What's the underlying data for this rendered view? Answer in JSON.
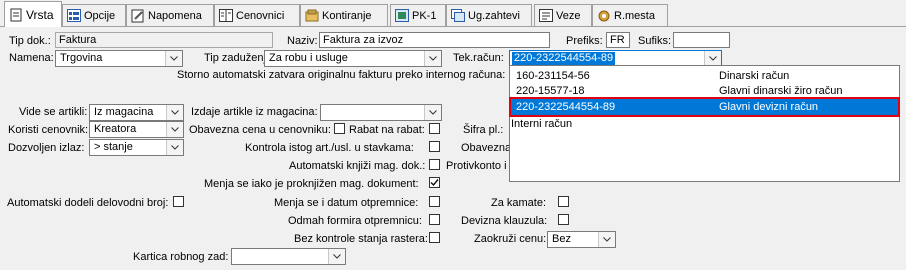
{
  "tabs": [
    {
      "label": "Vrsta",
      "icon": "document-icon"
    },
    {
      "label": "Opcije",
      "icon": "options-grid-icon"
    },
    {
      "label": "Napomena",
      "icon": "note-icon"
    },
    {
      "label": "Cenovnici",
      "icon": "price-list-icon"
    },
    {
      "label": "Kontiranje",
      "icon": "accounting-icon"
    },
    {
      "label": "PK-1",
      "icon": "pk1-icon"
    },
    {
      "label": "Ug.zahtevi",
      "icon": "requirements-icon"
    },
    {
      "label": "Veze",
      "icon": "links-icon"
    },
    {
      "label": "R.mesta",
      "icon": "cost-center-icon"
    }
  ],
  "form": {
    "tip_dok_label": "Tip dok.:",
    "tip_dok_value": "Faktura",
    "naziv_label": "Naziv:",
    "naziv_value": "Faktura za izvoz",
    "prefiks_label": "Prefiks:",
    "prefiks_value": "FR",
    "sufiks_label": "Sufiks:",
    "sufiks_value": "",
    "namena_label": "Namena:",
    "namena_value": "Trgovina",
    "tip_zaduzenja_label": "Tip zaduženja:",
    "tip_zaduzenja_value": "Za robu i usluge",
    "tek_racun_label": "Tek.račun:",
    "tek_racun_value": "220-2322544554-89",
    "storno_label": "Storno automatski zatvara originalnu fakturu preko internog računa:",
    "vide_se_artikli_label": "Vide se artikli:",
    "vide_se_artikli_value": "Iz magacina",
    "izdaje_artikle_label": "Izdaje artikle iz magacina:",
    "izdaje_artikle_value": "",
    "koristi_cenovnik_label": "Koristi cenovnik:",
    "koristi_cenovnik_value": "Kreatora",
    "obavezna_cena_label": "Obavezna cena u cenovniku:",
    "rabat_label": "Rabat na rabat:",
    "sifra_label": "Šifra pl.:",
    "dozvoljen_izlaz_label": "Dozvoljen izlaz:",
    "dozvoljen_izlaz_value": "> stanje",
    "kontrola_label": "Kontrola istog art./usl. u stavkama:",
    "obavezna_label": "Obavezna",
    "automatski_knjizi_label": "Automatski knjiži mag. dok.:",
    "protivkonto_label": "Protivkonto i",
    "menja_proknjizen_label": "Menja se iako je proknjižen mag. dokument:",
    "menja_proknjizen_checked": true,
    "auto_delovodni_label": "Automatski dodeli delovodni broj:",
    "menja_datum_label": "Menja se i datum otpremnice:",
    "za_kamate_label": "Za kamate:",
    "odmah_formira_label": "Odmah formira otpremnicu:",
    "devizna_klauzula_label": "Devizna klauzula:",
    "bez_kontrole_label": "Bez kontrole stanja rastera:",
    "zaokruzi_label": "Zaokruži cenu:",
    "zaokruzi_value": "Bez",
    "kartica_label": "Kartica robnog zad:",
    "kartica_value": ""
  },
  "dropdown": {
    "items": [
      {
        "account": "160-231154-56",
        "desc": "Dinarski račun"
      },
      {
        "account": "220-15577-18",
        "desc": "Glavni dinarski žiro račun"
      },
      {
        "account": "220-2322544554-89",
        "desc": "Glavni devizni račun",
        "selected": true
      },
      {
        "account": "Interni račun",
        "desc": ""
      }
    ]
  },
  "colors": {
    "selection": "#0078d7",
    "highlight_outline": "#e3000f"
  }
}
